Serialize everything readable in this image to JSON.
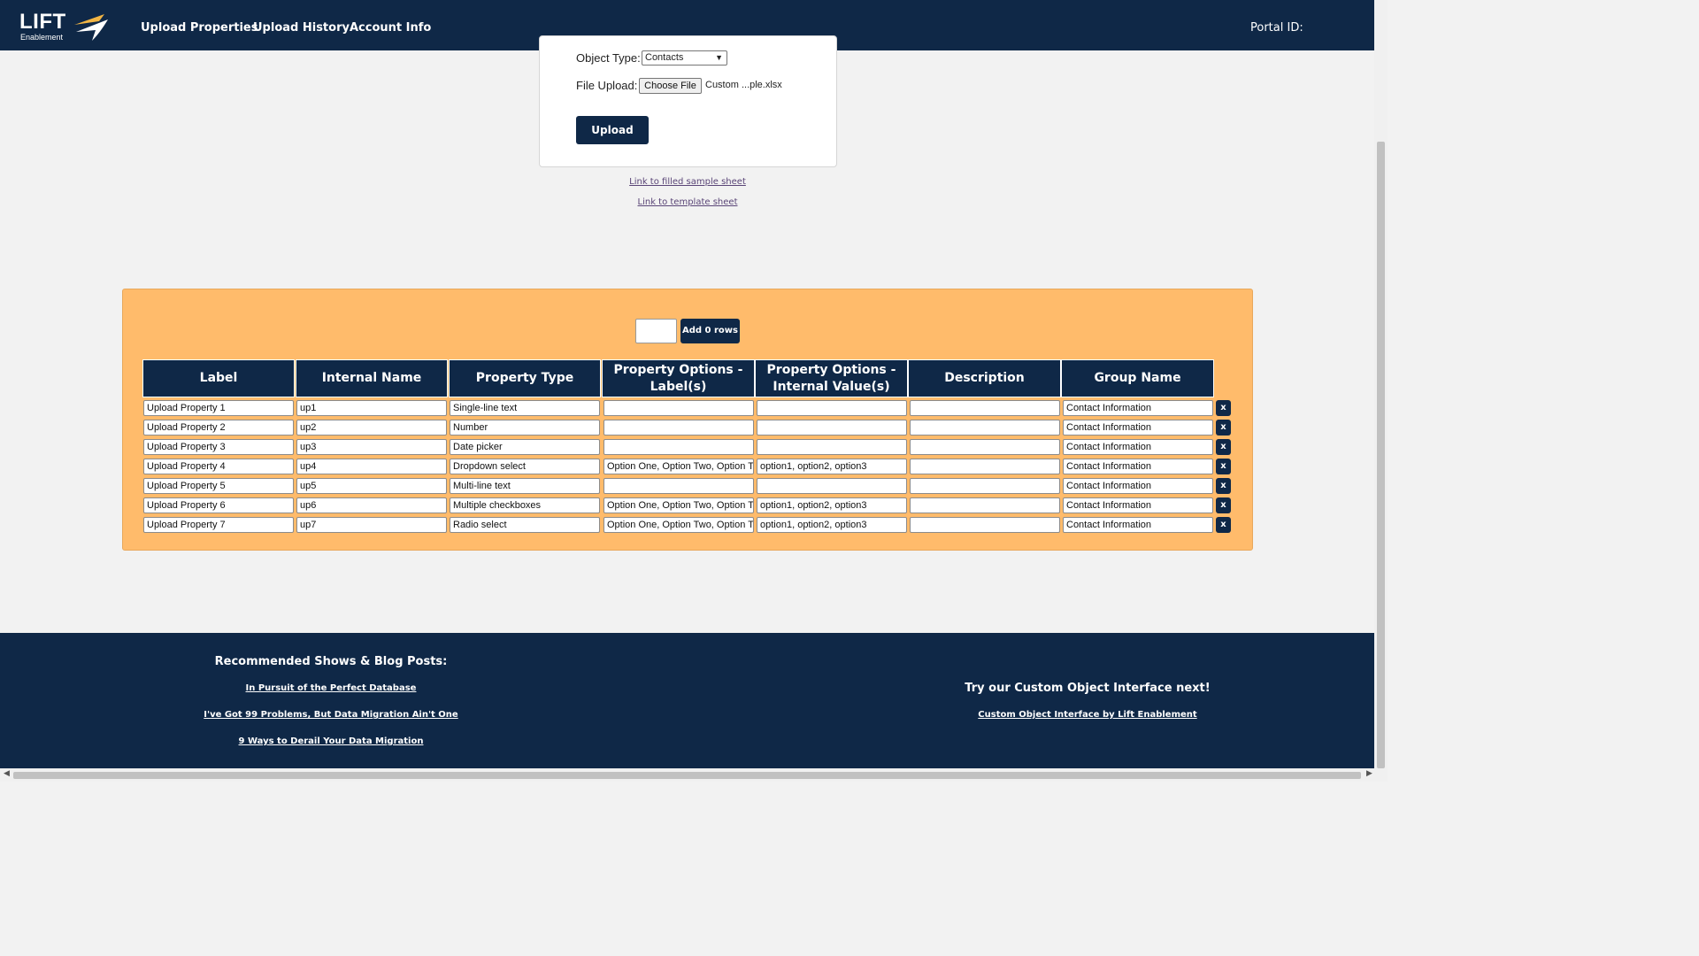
{
  "nav": {
    "logo_text": "LIFT",
    "logo_sub": "Enablement",
    "links": [
      "Upload Properties",
      "Upload History",
      "Account Info"
    ],
    "portal_label": "Portal ID:"
  },
  "upload_form": {
    "object_type_label": "Object Type:",
    "object_type_value": "Contacts",
    "file_upload_label": "File Upload:",
    "choose_file_label": "Choose File",
    "file_name": "Custom ...ple.xlsx",
    "upload_button": "Upload",
    "sample_link": "Link to filled sample sheet",
    "template_link": "Link to template sheet"
  },
  "rows_control": {
    "input_value": "",
    "add_button": "Add 0 rows"
  },
  "table": {
    "headers": [
      "Label",
      "Internal Name",
      "Property Type",
      "Property Options - Label(s)",
      "Property Options - Internal Value(s)",
      "Description",
      "Group Name"
    ],
    "delete_label": "x",
    "rows": [
      [
        "Upload Property 1",
        "up1",
        "Single-line text",
        "",
        "",
        "",
        "Contact Information"
      ],
      [
        "Upload Property 2",
        "up2",
        "Number",
        "",
        "",
        "",
        "Contact Information"
      ],
      [
        "Upload Property 3",
        "up3",
        "Date picker",
        "",
        "",
        "",
        "Contact Information"
      ],
      [
        "Upload Property 4",
        "up4",
        "Dropdown select",
        "Option One, Option Two, Option Three",
        "option1, option2, option3",
        "",
        "Contact Information"
      ],
      [
        "Upload Property 5",
        "up5",
        "Multi-line text",
        "",
        "",
        "",
        "Contact Information"
      ],
      [
        "Upload Property 6",
        "up6",
        "Multiple checkboxes",
        "Option One, Option Two, Option Three",
        "option1, option2, option3",
        "",
        "Contact Information"
      ],
      [
        "Upload Property 7",
        "up7",
        "Radio select",
        "Option One, Option Two, Option Three",
        "option1, option2, option3",
        "",
        "Contact Information"
      ]
    ]
  },
  "footer": {
    "recommended_heading": "Recommended Shows & Blog Posts:",
    "recommended_links": [
      "In Pursuit of the Perfect Database",
      "I've Got 99 Problems, But Data Migration Ain't One",
      "9 Ways to Derail Your Data Migration"
    ],
    "cta_heading": "Try our Custom Object Interface next!",
    "cta_link": "Custom Object Interface by Lift Enablement"
  },
  "colors": {
    "navy": "#0f2847",
    "panel_orange": "#ffbb6b",
    "logo_accent": "#f2b544",
    "page_bg": "#f2f2f2"
  }
}
